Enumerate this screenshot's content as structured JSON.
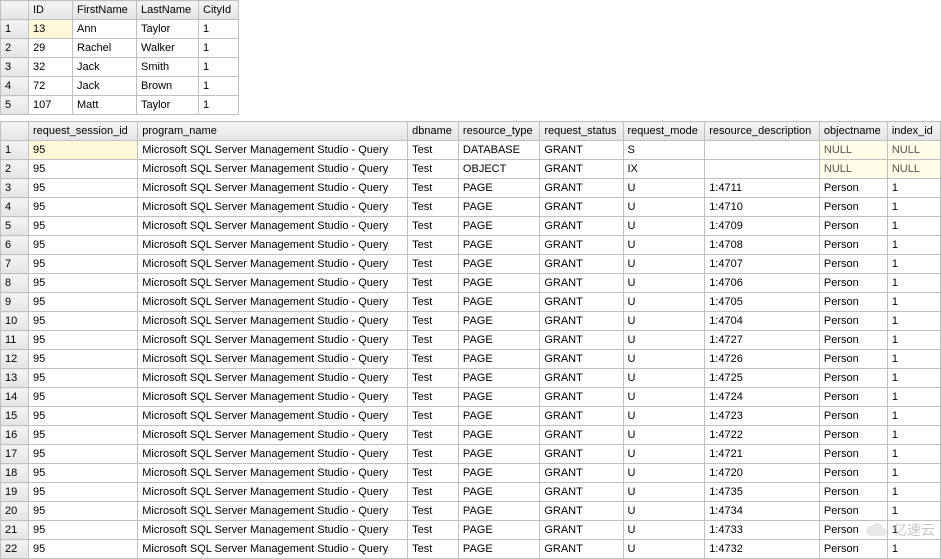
{
  "top_table": {
    "headers": [
      "ID",
      "FirstName",
      "LastName",
      "CityId"
    ],
    "rows": [
      {
        "n": "1",
        "cells": [
          "13",
          "Ann",
          "Taylor",
          "1"
        ]
      },
      {
        "n": "2",
        "cells": [
          "29",
          "Rachel",
          "Walker",
          "1"
        ]
      },
      {
        "n": "3",
        "cells": [
          "32",
          "Jack",
          "Smith",
          "1"
        ]
      },
      {
        "n": "4",
        "cells": [
          "72",
          "Jack",
          "Brown",
          "1"
        ]
      },
      {
        "n": "5",
        "cells": [
          "107",
          "Matt",
          "Taylor",
          "1"
        ]
      }
    ]
  },
  "bottom_table": {
    "headers": [
      "request_session_id",
      "program_name",
      "dbname",
      "resource_type",
      "request_status",
      "request_mode",
      "resource_description",
      "objectname",
      "index_id"
    ],
    "null_text": "NULL",
    "rows": [
      {
        "n": "1",
        "cells": [
          "95",
          "Microsoft SQL Server Management Studio - Query",
          "Test",
          "DATABASE",
          "GRANT",
          "S",
          "",
          "NULL",
          "NULL"
        ]
      },
      {
        "n": "2",
        "cells": [
          "95",
          "Microsoft SQL Server Management Studio - Query",
          "Test",
          "OBJECT",
          "GRANT",
          "IX",
          "",
          "NULL",
          "NULL"
        ]
      },
      {
        "n": "3",
        "cells": [
          "95",
          "Microsoft SQL Server Management Studio - Query",
          "Test",
          "PAGE",
          "GRANT",
          "U",
          "1:4711",
          "Person",
          "1"
        ]
      },
      {
        "n": "4",
        "cells": [
          "95",
          "Microsoft SQL Server Management Studio - Query",
          "Test",
          "PAGE",
          "GRANT",
          "U",
          "1:4710",
          "Person",
          "1"
        ]
      },
      {
        "n": "5",
        "cells": [
          "95",
          "Microsoft SQL Server Management Studio - Query",
          "Test",
          "PAGE",
          "GRANT",
          "U",
          "1:4709",
          "Person",
          "1"
        ]
      },
      {
        "n": "6",
        "cells": [
          "95",
          "Microsoft SQL Server Management Studio - Query",
          "Test",
          "PAGE",
          "GRANT",
          "U",
          "1:4708",
          "Person",
          "1"
        ]
      },
      {
        "n": "7",
        "cells": [
          "95",
          "Microsoft SQL Server Management Studio - Query",
          "Test",
          "PAGE",
          "GRANT",
          "U",
          "1:4707",
          "Person",
          "1"
        ]
      },
      {
        "n": "8",
        "cells": [
          "95",
          "Microsoft SQL Server Management Studio - Query",
          "Test",
          "PAGE",
          "GRANT",
          "U",
          "1:4706",
          "Person",
          "1"
        ]
      },
      {
        "n": "9",
        "cells": [
          "95",
          "Microsoft SQL Server Management Studio - Query",
          "Test",
          "PAGE",
          "GRANT",
          "U",
          "1:4705",
          "Person",
          "1"
        ]
      },
      {
        "n": "10",
        "cells": [
          "95",
          "Microsoft SQL Server Management Studio - Query",
          "Test",
          "PAGE",
          "GRANT",
          "U",
          "1:4704",
          "Person",
          "1"
        ]
      },
      {
        "n": "11",
        "cells": [
          "95",
          "Microsoft SQL Server Management Studio - Query",
          "Test",
          "PAGE",
          "GRANT",
          "U",
          "1:4727",
          "Person",
          "1"
        ]
      },
      {
        "n": "12",
        "cells": [
          "95",
          "Microsoft SQL Server Management Studio - Query",
          "Test",
          "PAGE",
          "GRANT",
          "U",
          "1:4726",
          "Person",
          "1"
        ]
      },
      {
        "n": "13",
        "cells": [
          "95",
          "Microsoft SQL Server Management Studio - Query",
          "Test",
          "PAGE",
          "GRANT",
          "U",
          "1:4725",
          "Person",
          "1"
        ]
      },
      {
        "n": "14",
        "cells": [
          "95",
          "Microsoft SQL Server Management Studio - Query",
          "Test",
          "PAGE",
          "GRANT",
          "U",
          "1:4724",
          "Person",
          "1"
        ]
      },
      {
        "n": "15",
        "cells": [
          "95",
          "Microsoft SQL Server Management Studio - Query",
          "Test",
          "PAGE",
          "GRANT",
          "U",
          "1:4723",
          "Person",
          "1"
        ]
      },
      {
        "n": "16",
        "cells": [
          "95",
          "Microsoft SQL Server Management Studio - Query",
          "Test",
          "PAGE",
          "GRANT",
          "U",
          "1:4722",
          "Person",
          "1"
        ]
      },
      {
        "n": "17",
        "cells": [
          "95",
          "Microsoft SQL Server Management Studio - Query",
          "Test",
          "PAGE",
          "GRANT",
          "U",
          "1:4721",
          "Person",
          "1"
        ]
      },
      {
        "n": "18",
        "cells": [
          "95",
          "Microsoft SQL Server Management Studio - Query",
          "Test",
          "PAGE",
          "GRANT",
          "U",
          "1:4720",
          "Person",
          "1"
        ]
      },
      {
        "n": "19",
        "cells": [
          "95",
          "Microsoft SQL Server Management Studio - Query",
          "Test",
          "PAGE",
          "GRANT",
          "U",
          "1:4735",
          "Person",
          "1"
        ]
      },
      {
        "n": "20",
        "cells": [
          "95",
          "Microsoft SQL Server Management Studio - Query",
          "Test",
          "PAGE",
          "GRANT",
          "U",
          "1:4734",
          "Person",
          "1"
        ]
      },
      {
        "n": "21",
        "cells": [
          "95",
          "Microsoft SQL Server Management Studio - Query",
          "Test",
          "PAGE",
          "GRANT",
          "U",
          "1:4733",
          "Person",
          "1"
        ]
      },
      {
        "n": "22",
        "cells": [
          "95",
          "Microsoft SQL Server Management Studio - Query",
          "Test",
          "PAGE",
          "GRANT",
          "U",
          "1:4732",
          "Person",
          "1"
        ]
      }
    ]
  },
  "watermark": "亿速云"
}
